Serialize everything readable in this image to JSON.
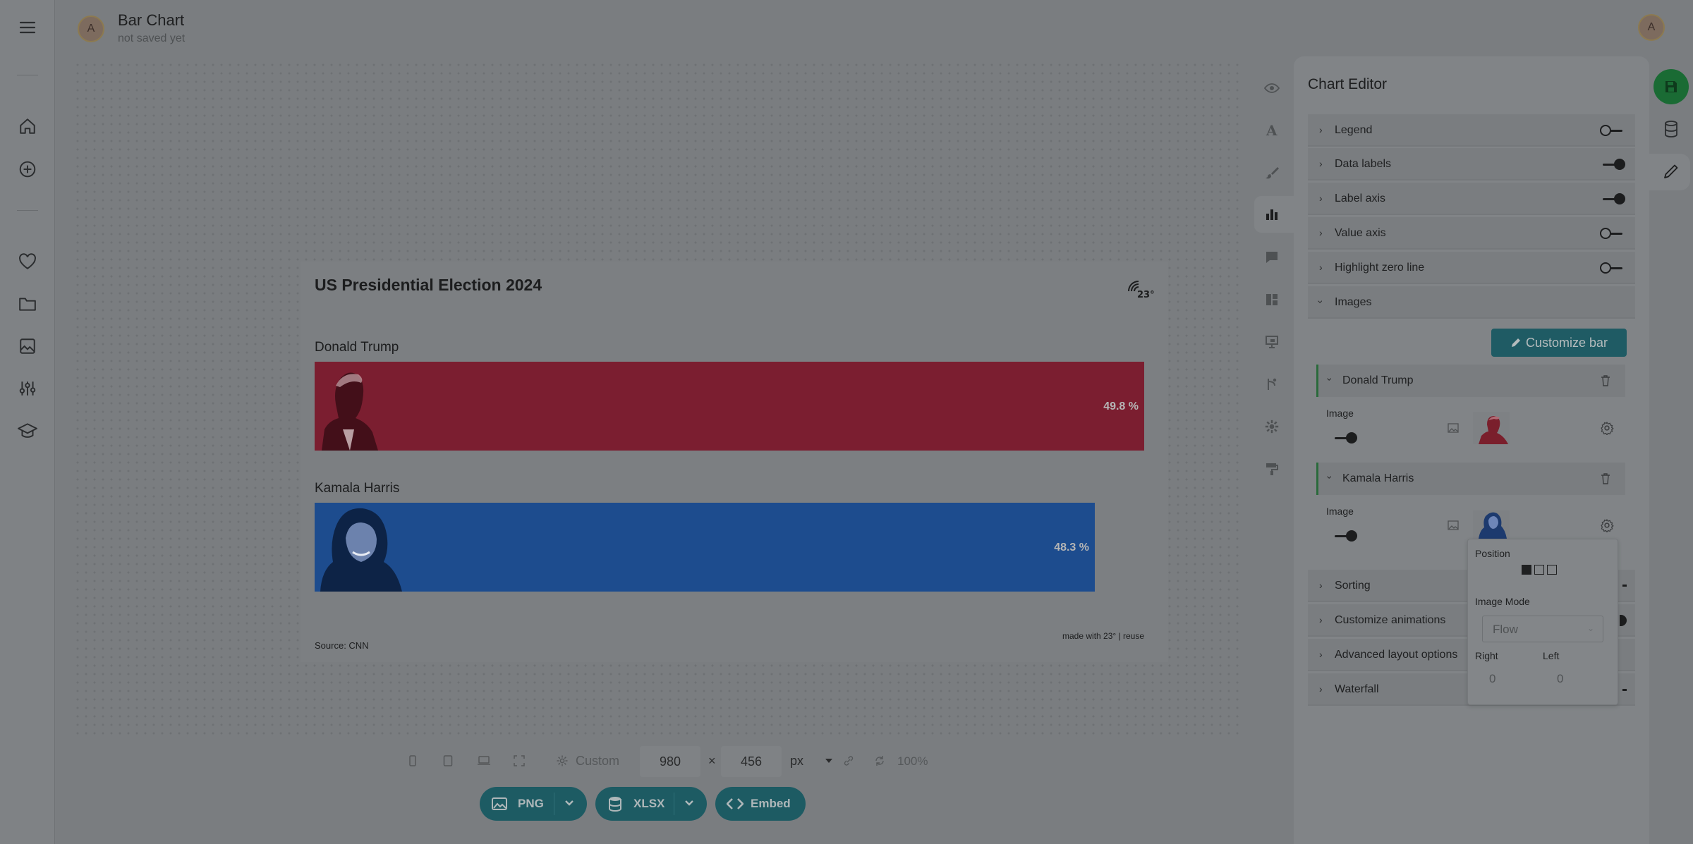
{
  "app": {
    "title": "Bar Chart",
    "status": "not saved yet",
    "user_initial": "A"
  },
  "chart": {
    "title": "US Presidential Election 2024",
    "logo_text": "23°",
    "source": "Source: CNN",
    "credit": "made with 23° | reuse"
  },
  "chart_data": {
    "type": "bar",
    "title": "US Presidential Election 2024",
    "orientation": "horizontal",
    "categories": [
      "Donald Trump",
      "Kamala Harris"
    ],
    "values": [
      49.8,
      48.3
    ],
    "value_labels": [
      "49.8 %",
      "48.3 %"
    ],
    "colors": [
      "#7b1e30",
      "#1d4c8e"
    ],
    "unit": "%",
    "source": "Source: CNN",
    "xlabel": "",
    "ylabel": ""
  },
  "size_toolbar": {
    "preset": "Custom",
    "width": "980",
    "height": "456",
    "unit": "px",
    "times": "×",
    "zoom": "100%"
  },
  "export": {
    "png": "PNG",
    "xlsx": "XLSX",
    "embed": "Embed"
  },
  "editor": {
    "title": "Chart Editor",
    "sections": [
      {
        "label": "Legend",
        "toggle": "off"
      },
      {
        "label": "Data labels",
        "toggle": "on"
      },
      {
        "label": "Label axis",
        "toggle": "on"
      },
      {
        "label": "Value axis",
        "toggle": "off"
      },
      {
        "label": "Highlight zero line",
        "toggle": "off"
      },
      {
        "label": "Images",
        "toggle": "none"
      }
    ],
    "customize_bar": "Customize bar",
    "image_items": [
      {
        "name": "Donald Trump",
        "field_label": "Image"
      },
      {
        "name": "Kamala Harris",
        "field_label": "Image"
      }
    ],
    "lower_sections": [
      {
        "label": "Sorting"
      },
      {
        "label": "Customize animations"
      },
      {
        "label": "Advanced layout options"
      },
      {
        "label": "Waterfall"
      }
    ]
  },
  "popover": {
    "position_label": "Position",
    "image_mode_label": "Image Mode",
    "image_mode_value": "Flow",
    "right_label": "Right",
    "left_label": "Left",
    "right_value": "0",
    "left_value": "0"
  },
  "colors": {
    "trump_bar": "#7b1e30",
    "harris_bar": "#1d4c8e",
    "accent": "#1d5b63",
    "save": "#1a6b34"
  }
}
